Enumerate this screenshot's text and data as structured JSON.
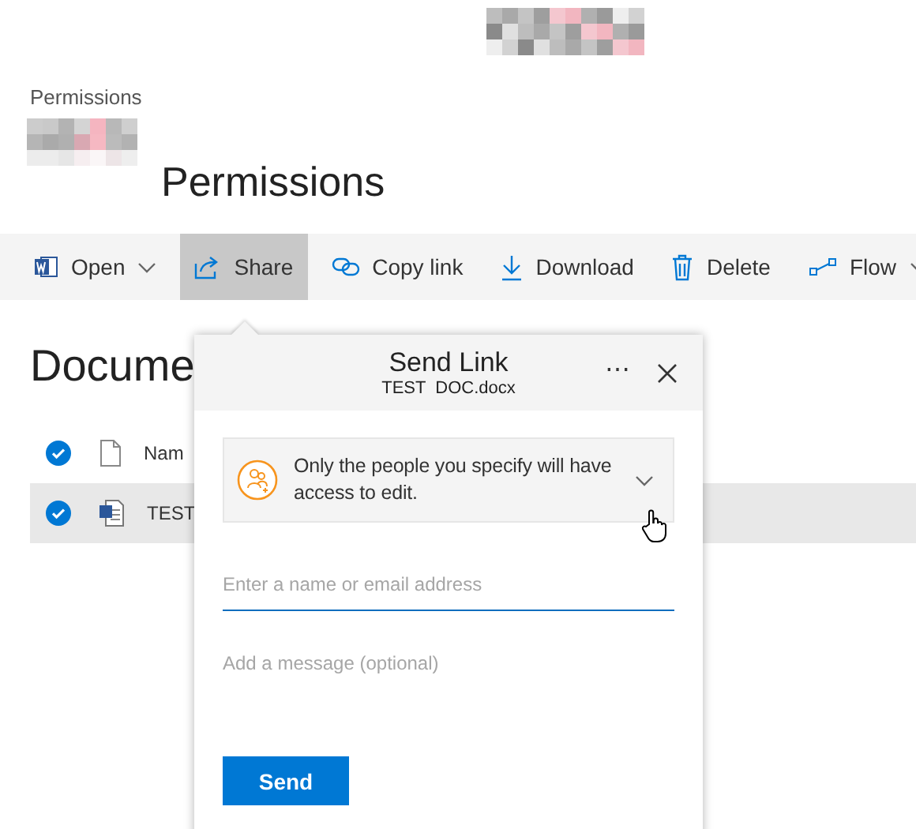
{
  "breadcrumb": "Permissions",
  "site_title": "Permissions",
  "commands": [
    {
      "label": "Open",
      "kind": "word",
      "has_menu": true,
      "selected": false
    },
    {
      "label": "Share",
      "kind": "share",
      "has_menu": false,
      "selected": true
    },
    {
      "label": "Copy link",
      "kind": "link",
      "has_menu": false,
      "selected": false
    },
    {
      "label": "Download",
      "kind": "download",
      "has_menu": false,
      "selected": false
    },
    {
      "label": "Delete",
      "kind": "delete",
      "has_menu": false,
      "selected": false
    },
    {
      "label": "Flow",
      "kind": "flow",
      "has_menu": true,
      "selected": false
    }
  ],
  "library": {
    "heading": "Docume",
    "header": {
      "name": "Nam",
      "checked": true
    },
    "rows": [
      {
        "name": "TEST",
        "checked": true,
        "selected": true
      }
    ]
  },
  "dialog": {
    "title": "Send Link",
    "file": "TEST  DOC.docx",
    "more": "⋯",
    "link_setting": "Only the people you specify will have access to edit.",
    "recipients": {
      "placeholder": "Enter a name or email address"
    },
    "message": {
      "placeholder": "Add a message (optional)"
    },
    "send": "Send"
  }
}
